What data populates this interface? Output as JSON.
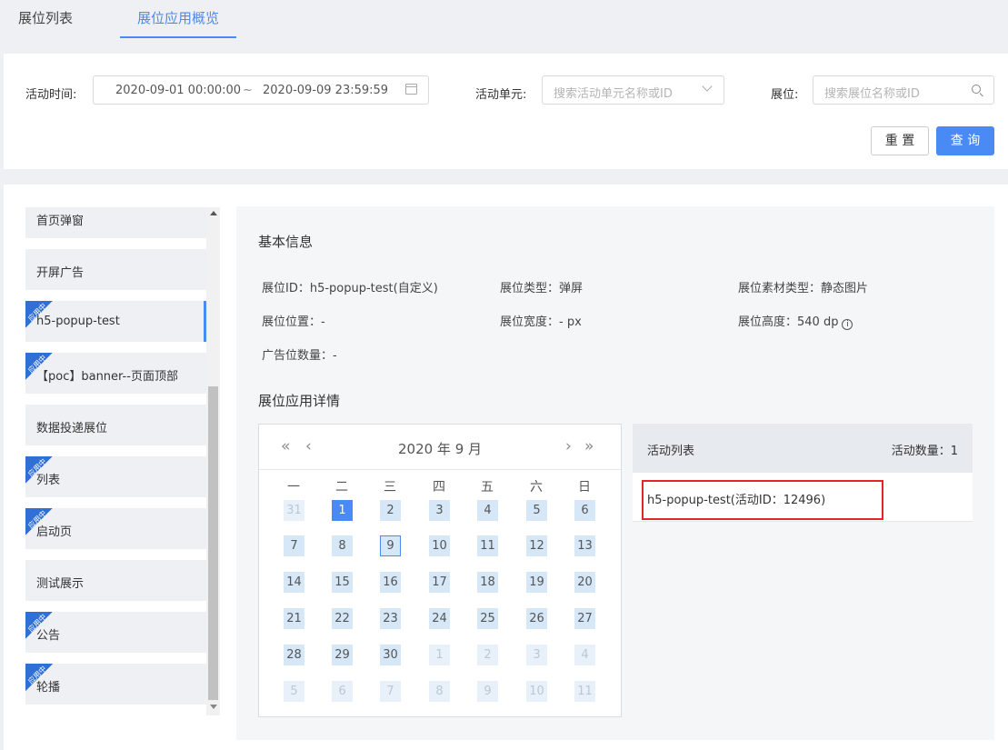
{
  "tabs": [
    {
      "label": "展位列表"
    },
    {
      "label": "展位应用概览"
    }
  ],
  "filters": {
    "time_label": "活动时间:",
    "start": "2020-09-01 00:00:00",
    "sep": "~",
    "end": "2020-09-09 23:59:59",
    "unit_label": "活动单元:",
    "unit_placeholder": "搜索活动单元名称或ID",
    "slot_label": "展位:",
    "slot_placeholder": "搜索展位名称或ID",
    "reset": "重 置",
    "query": "查 询"
  },
  "slots": [
    {
      "label": "首页弹窗",
      "badge": ""
    },
    {
      "label": "开屏广告",
      "badge": ""
    },
    {
      "label": "h5-popup-test",
      "badge": "应用中"
    },
    {
      "label": "【poc】banner--页面顶部",
      "badge": "应用中"
    },
    {
      "label": "数据投递展位",
      "badge": ""
    },
    {
      "label": "列表",
      "badge": "应用中"
    },
    {
      "label": "启动页",
      "badge": "应用中"
    },
    {
      "label": "测试展示",
      "badge": ""
    },
    {
      "label": "公告",
      "badge": "应用中"
    },
    {
      "label": "轮播",
      "badge": "应用中"
    }
  ],
  "basic": {
    "title": "基本信息",
    "id": "展位ID：h5-popup-test(自定义)",
    "type": "展位类型：弹屏",
    "material": "展位素材类型：静态图片",
    "position": "展位位置：-",
    "width": "展位宽度：- px",
    "height": "展位高度：540 dp",
    "ad_count": "广告位数量：-"
  },
  "detail_title": "展位应用详情",
  "calendar": {
    "title": "2020 年 9 月",
    "weekdays": [
      "一",
      "二",
      "三",
      "四",
      "五",
      "六",
      "日"
    ],
    "days": [
      [
        "31",
        "1",
        "2",
        "3",
        "4",
        "5",
        "6"
      ],
      [
        "7",
        "8",
        "9",
        "10",
        "11",
        "12",
        "13"
      ],
      [
        "14",
        "15",
        "16",
        "17",
        "18",
        "19",
        "20"
      ],
      [
        "21",
        "22",
        "23",
        "24",
        "25",
        "26",
        "27"
      ],
      [
        "28",
        "29",
        "30",
        "1",
        "2",
        "3",
        "4"
      ],
      [
        "5",
        "6",
        "7",
        "8",
        "9",
        "10",
        "11"
      ]
    ]
  },
  "activities": {
    "title": "活动列表",
    "count": "活动数量：1",
    "items": [
      "h5-popup-test(活动ID：12496)"
    ]
  },
  "colors": {
    "accent": "#4a8af4",
    "badge": "#2f6fd6",
    "highlight": "#e3242b"
  }
}
